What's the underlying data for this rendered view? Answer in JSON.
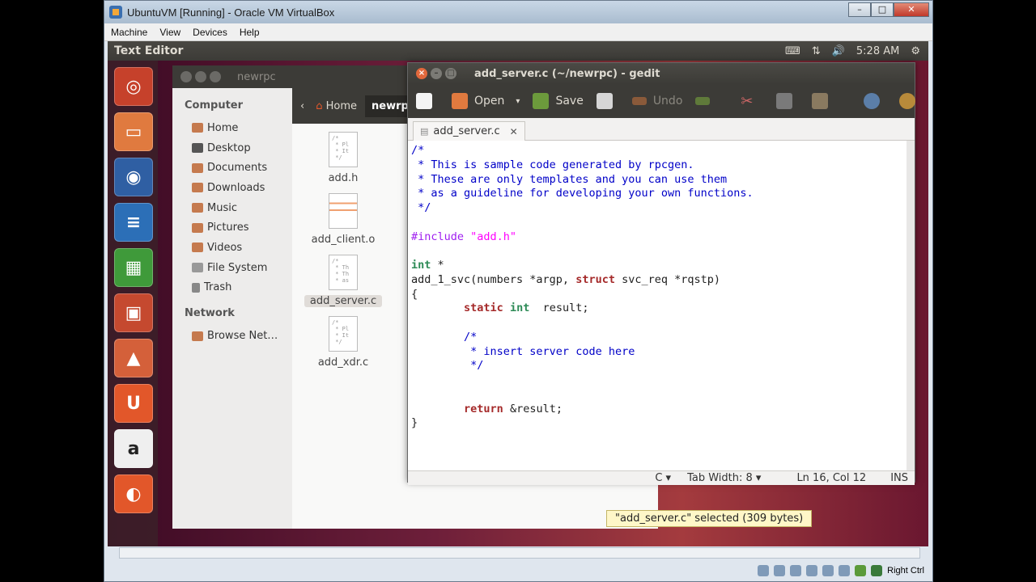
{
  "vbox": {
    "title": "UbuntuVM [Running] - Oracle VM VirtualBox",
    "menu": [
      "Machine",
      "View",
      "Devices",
      "Help"
    ],
    "host_key": "Right Ctrl"
  },
  "ubuntu": {
    "app_name": "Text Editor",
    "time": "5:28 AM"
  },
  "nautilus": {
    "title": "newrpc",
    "breadcrumb_home": "Home",
    "breadcrumb_current": "newrpc",
    "sidebar": {
      "computer_heading": "Computer",
      "items": [
        "Home",
        "Desktop",
        "Documents",
        "Downloads",
        "Music",
        "Pictures",
        "Videos",
        "File System",
        "Trash"
      ],
      "network_heading": "Network",
      "network_items": [
        "Browse Net…"
      ]
    },
    "files": [
      {
        "name": "add.h",
        "preview": "/*\n * Pl\n * It\n */"
      },
      {
        "name": "add_client.o",
        "preview": ""
      },
      {
        "name": "add_server.c",
        "preview": "/*\n * Th\n * Th\n * as"
      },
      {
        "name": "add_xdr.c",
        "preview": "/*\n * Pl\n * It\n */"
      }
    ]
  },
  "gedit": {
    "title": "add_server.c (~/newrpc) - gedit",
    "toolbar": {
      "open": "Open",
      "save": "Save",
      "undo": "Undo"
    },
    "tab_label": "add_server.c",
    "status": {
      "language": "C ▾",
      "tab_width": "Tab Width: 8 ▾",
      "position": "Ln 16, Col 12",
      "mode": "INS"
    }
  },
  "tooltip": "\"add_server.c\" selected (309 bytes)"
}
